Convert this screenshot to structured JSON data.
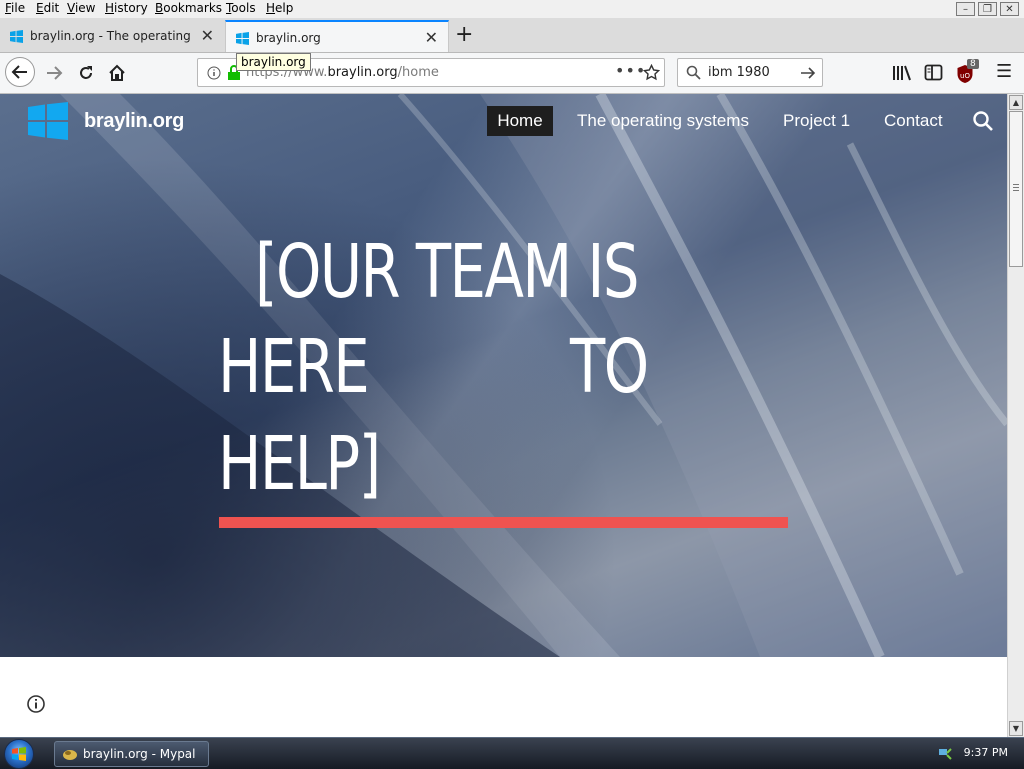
{
  "menu": {
    "items": [
      {
        "accel": "F",
        "rest": "ile"
      },
      {
        "accel": "E",
        "rest": "dit"
      },
      {
        "accel": "V",
        "rest": "iew"
      },
      {
        "accel": "H",
        "rest": "istory"
      },
      {
        "accel": "B",
        "rest": "ookmarks"
      },
      {
        "accel": "T",
        "rest": "ools"
      },
      {
        "accel": "H",
        "rest": "elp"
      }
    ]
  },
  "tabs": [
    {
      "title": "braylin.org - The operating syst"
    },
    {
      "title": "braylin.org"
    }
  ],
  "tooltip": "braylin.org",
  "url": {
    "prefix": "https://www.",
    "domain": "braylin.org",
    "path": "/home"
  },
  "search": {
    "value": "ibm 1980"
  },
  "ublock_badge": "8",
  "site": {
    "name": "braylin.org",
    "nav": {
      "home": "Home",
      "os": "The operating systems",
      "project": "Project 1",
      "contact": "Contact"
    },
    "hero": {
      "line1": "[OUR TEAM IS",
      "line2a": "HERE",
      "line2b": "TO",
      "line3": "HELP]"
    },
    "colors": {
      "accent": "#ef5350",
      "nav_active_bg": "#1e1e1e"
    }
  },
  "taskbar": {
    "task_label": "braylin.org - Mypal",
    "clock": "9:37 PM"
  }
}
